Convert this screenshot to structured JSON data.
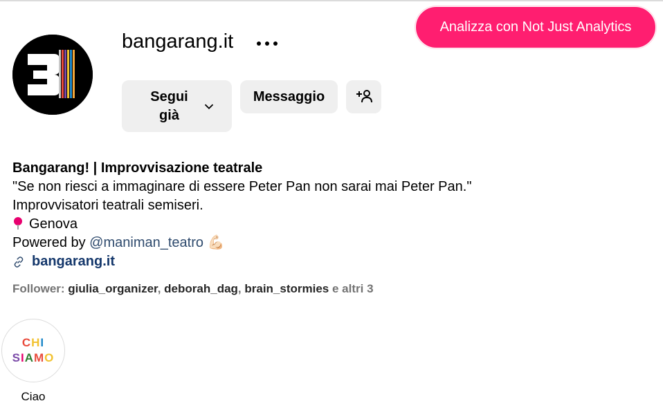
{
  "header": {
    "username": "bangarang.it",
    "analyze_button": "Analizza con Not Just Analytics",
    "more_icon": "more-horizontal-icon"
  },
  "actions": {
    "follow_button": "Segui già",
    "message_button": "Messaggio",
    "add_user_icon": "person-add-icon"
  },
  "bio": {
    "name": "Bangarang! | Improvvisazione teatrale",
    "quote": "\"Se non riesci a immaginare di essere Peter Pan non sarai mai Peter Pan.\"",
    "tagline": "Improvvisatori teatrali semiseri.",
    "location": "Genova",
    "powered_prefix": "Powered by ",
    "powered_mention": "@maniman_teatro",
    "powered_emoji": "💪🏻",
    "link": "bangarang.it"
  },
  "followers": {
    "prefix": "Follower: ",
    "names": [
      "giulia_organizer",
      "deborah_dag",
      "brain_stormies"
    ],
    "suffix": " e altri 3"
  },
  "highlights": [
    {
      "line1": "CHI",
      "line2": "SIAMO",
      "label": "Ciao"
    }
  ],
  "colors": {
    "accent": "#ff1e70",
    "button_bg": "#efefef",
    "link": "#14376b"
  }
}
